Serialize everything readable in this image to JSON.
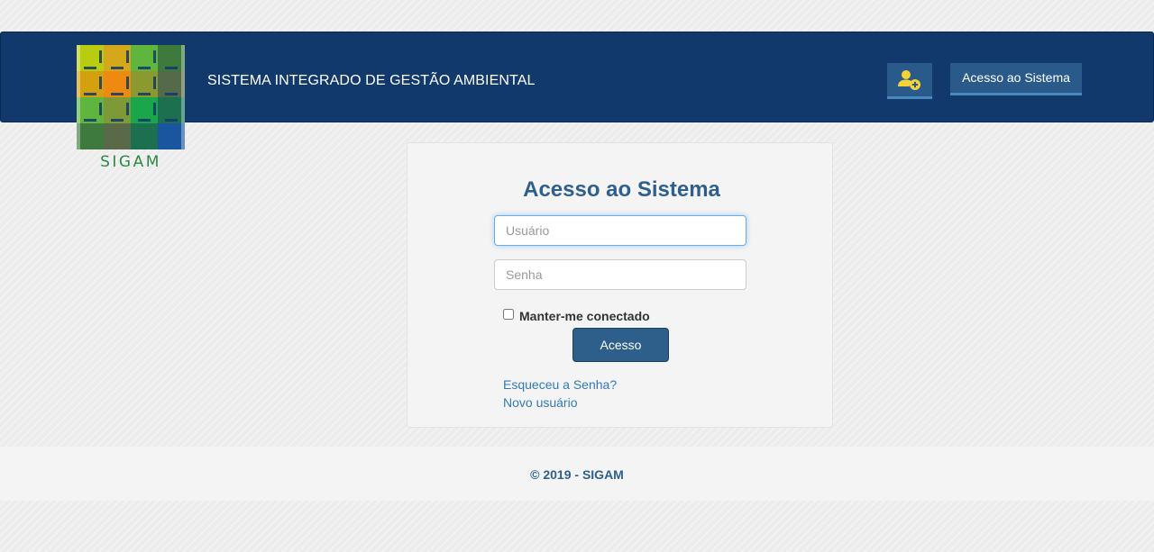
{
  "header": {
    "logo_text": "SIGAM",
    "brand_title": "SISTEMA INTEGRADO DE GESTÃO AMBIENTAL",
    "add_user_icon": "user-plus-icon",
    "nav_access_label": "Acesso ao Sistema"
  },
  "login": {
    "title": "Acesso ao Sistema",
    "username_placeholder": "Usuário",
    "username_value": "",
    "password_placeholder": "Senha",
    "password_value": "",
    "remember_label": "Manter-me conectado",
    "remember_checked": false,
    "submit_label": "Acesso",
    "forgot_link": "Esqueceu a Senha?",
    "new_user_link": "Novo usuário"
  },
  "footer": {
    "copyright": "© 2019 - SIGAM"
  },
  "colors": {
    "navbar": "#12396c",
    "button": "#2a5a8a",
    "accent_text": "#2f5f8d",
    "link": "#337ab7",
    "icon_yellow": "#f5d23a"
  }
}
